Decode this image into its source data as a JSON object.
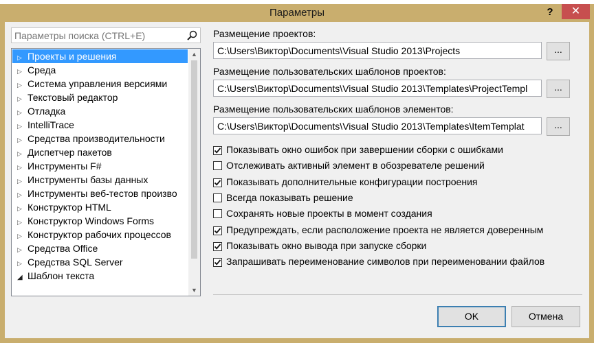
{
  "window": {
    "title": "Параметры",
    "help_label": "?",
    "close_label": "✕"
  },
  "search": {
    "placeholder": "Параметры поиска (CTRL+E)",
    "icon": "search-icon"
  },
  "tree": {
    "items": [
      {
        "label": "Проекты и решения"
      },
      {
        "label": "Среда"
      },
      {
        "label": "Система управления версиями"
      },
      {
        "label": "Текстовый редактор"
      },
      {
        "label": "Отладка"
      },
      {
        "label": "IntelliTrace"
      },
      {
        "label": "Средства производительности"
      },
      {
        "label": "Диспетчер пакетов"
      },
      {
        "label": "Инструменты F#"
      },
      {
        "label": "Инструменты базы данных"
      },
      {
        "label": "Инструменты веб-тестов произво"
      },
      {
        "label": "Конструктор HTML"
      },
      {
        "label": "Конструктор Windows Forms"
      },
      {
        "label": "Конструктор рабочих процессов"
      },
      {
        "label": "Средства Office"
      },
      {
        "label": "Средства SQL Server"
      },
      {
        "label": "Шаблон текста"
      }
    ],
    "selected_index": 0,
    "expanded_index": 16
  },
  "fields": [
    {
      "label": "Размещение проектов:",
      "value": "C:\\Users\\Виктор\\Documents\\Visual Studio 2013\\Projects",
      "browse_label": "..."
    },
    {
      "label": "Размещение пользовательских шаблонов проектов:",
      "value": "C:\\Users\\Виктор\\Documents\\Visual Studio 2013\\Templates\\ProjectTempl",
      "browse_label": "..."
    },
    {
      "label": "Размещение пользовательских шаблонов элементов:",
      "value": "C:\\Users\\Виктор\\Documents\\Visual Studio 2013\\Templates\\ItemTemplat",
      "browse_label": "..."
    }
  ],
  "options": [
    {
      "label": "Показывать окно ошибок при завершении сборки с ошибками",
      "checked": true
    },
    {
      "label": "Отслеживать активный элемент в обозревателе решений",
      "checked": false
    },
    {
      "label": "Показывать дополнительные конфигурации построения",
      "checked": true
    },
    {
      "label": "Всегда показывать решение",
      "checked": false
    },
    {
      "label": "Сохранять новые проекты в момент создания",
      "checked": false
    },
    {
      "label": "Предупреждать, если расположение проекта не является доверенным",
      "checked": true
    },
    {
      "label": "Показывать окно вывода при запуске сборки",
      "checked": true
    },
    {
      "label": "Запрашивать переименование символов при переименовании файлов",
      "checked": true
    }
  ],
  "buttons": {
    "ok": "OK",
    "cancel": "Отмена"
  },
  "colors": {
    "selection": "#3399ff",
    "close_button": "#c74f4f",
    "frame": "#c9ae6e"
  }
}
